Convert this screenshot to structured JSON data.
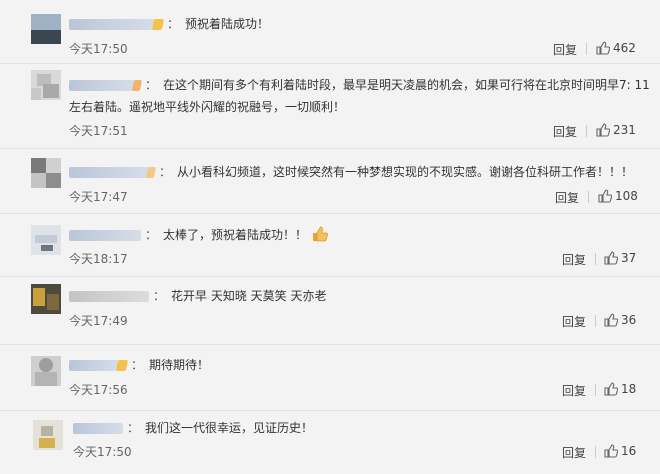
{
  "comments": [
    {
      "text": "预祝着陆成功！",
      "time": "今天17:50",
      "reply": "回复",
      "likes": "462"
    },
    {
      "text": "在这个期间有多个有利着陆时段，最早是明天凌晨的机会，如果可行将在北京时间明早7: 11",
      "text2": "左右着陆。遥祝地平线外闪耀的祝融号，一切顺利！",
      "time": "今天17:51",
      "reply": "回复",
      "likes": "231"
    },
    {
      "text": "从小看科幻频道，这时候突然有一种梦想实现的不现实感。谢谢各位科研工作者！！！",
      "time": "今天17:47",
      "reply": "回复",
      "likes": "108"
    },
    {
      "text": "太棒了，预祝着陆成功！！",
      "time": "今天18:17",
      "reply": "回复",
      "likes": "37",
      "emoji": "thumbs-up"
    },
    {
      "text": "花开早 天知晓 天莫笑 天亦老",
      "time": "今天17:49",
      "reply": "回复",
      "likes": "36"
    },
    {
      "text": "期待期待！",
      "time": "今天17:56",
      "reply": "回复",
      "likes": "18"
    },
    {
      "text": "我们这一代很幸运，见证历史！",
      "time": "今天17:50",
      "reply": "回复",
      "likes": "16"
    }
  ],
  "separator": "：",
  "icons": {
    "like": "thumbs-up-icon"
  }
}
